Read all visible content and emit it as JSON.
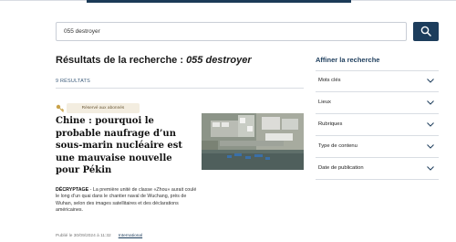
{
  "search": {
    "value": "055 destroyer",
    "button_icon": "search-icon"
  },
  "results": {
    "title_prefix": "Résultats de la recherche : ",
    "query": "055 destroyer",
    "count": "9 RÉSULTATS"
  },
  "article": {
    "badge": "Réservé aux abonnés",
    "title": "Chine : pourquoi le probable naufrage d’un sous-marin nucléaire est une mauvaise nouvelle pour Pékin",
    "kicker": "DÉCRYPTAGE",
    "description": " - La première unité de classe «Zhou» aurait coulé le long d’un quai dans le chantier naval de Wuchang, près de Wuhan, selon des images satellitaires et des déclarations américaines.",
    "published": "Publié le 30/09/2024 à 11:32",
    "section": "International"
  },
  "refine": {
    "title": "Affiner la recherche",
    "filters": [
      "Mots clés",
      "Lieux",
      "Rubriques",
      "Type de contenu",
      "Date de publication"
    ]
  },
  "colors": {
    "accent": "#1d3d5c",
    "badge_bg": "#f3ede0"
  }
}
